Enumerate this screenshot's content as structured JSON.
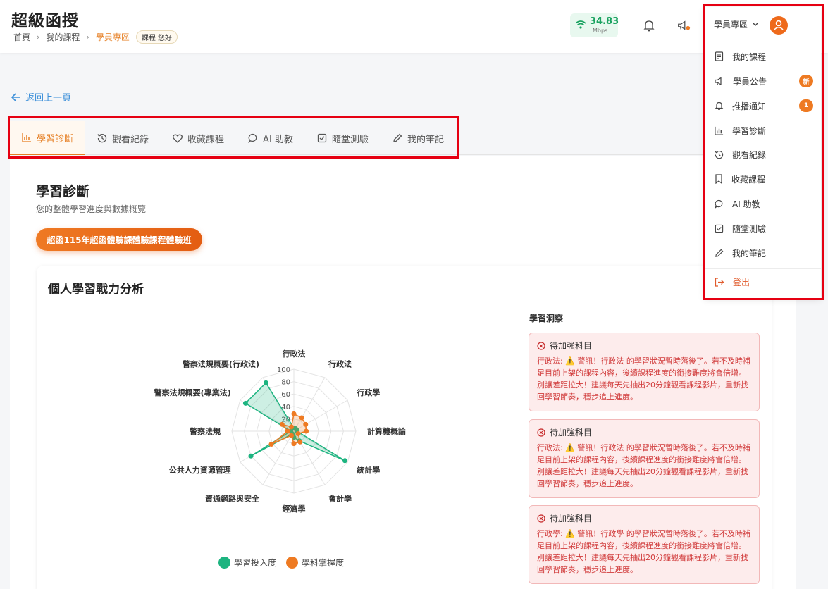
{
  "header": {
    "brand": "超級函授",
    "breadcrumb": [
      "首頁",
      "我的課程",
      "學員專區"
    ],
    "greeting_pill": "課程 您好",
    "speed_value": "34.83",
    "speed_unit": "Mbps"
  },
  "back_link": "返回上一頁",
  "tabs": [
    {
      "label": "學習診斷",
      "icon": "bar-chart-icon",
      "active": true
    },
    {
      "label": "觀看紀錄",
      "icon": "history-icon",
      "active": false
    },
    {
      "label": "收藏課程",
      "icon": "heart-icon",
      "active": false
    },
    {
      "label": "AI 助教",
      "icon": "chat-icon",
      "active": false
    },
    {
      "label": "隨堂測驗",
      "icon": "checkbox-icon",
      "active": false
    },
    {
      "label": "我的筆記",
      "icon": "pencil-icon",
      "active": false
    }
  ],
  "page": {
    "title": "學習診斷",
    "subtitle": "您的整體學習進度與數據概覽",
    "course_button": "超函115年超函體驗課體驗課程體驗班",
    "card_title": "個人學習戰力分析"
  },
  "chart_data": {
    "type": "radar",
    "categories": [
      "行政法",
      "行政法",
      "行政學",
      "計算機概論",
      "統計學",
      "會計學",
      "經濟學",
      "資通網路與安全",
      "公共人力資源管理",
      "警察法規",
      "警察法規概要(專業法)",
      "警察法規概要(行政法)"
    ],
    "ticks": [
      "100",
      "80",
      "60",
      "40",
      "20"
    ],
    "rmax": 100,
    "series": [
      {
        "name": "學習投入度",
        "color": "#1db480",
        "values": [
          5,
          5,
          5,
          5,
          95,
          18,
          10,
          5,
          80,
          5,
          90,
          90
        ]
      },
      {
        "name": "學科掌握度",
        "color": "#ee7a22",
        "values": [
          28,
          25,
          22,
          20,
          8,
          20,
          20,
          8,
          42,
          10,
          22,
          8
        ]
      }
    ]
  },
  "insights": {
    "title": "學習洞察",
    "alerts": [
      {
        "heading": "待加強科目",
        "body": "行政法: ⚠️ 警訊！行政法 的學習狀況暫時落後了。若不及時補足目前上架的課程內容，後續課程進度的銜接難度將會倍增。別讓差距拉大！建議每天先抽出20分鐘觀看課程影片，重新找回學習節奏，穩步追上進度。"
      },
      {
        "heading": "待加強科目",
        "body": "行政法: ⚠️ 警訊！行政法 的學習狀況暫時落後了。若不及時補足目前上架的課程內容，後續課程進度的銜接難度將會倍增。別讓差距拉大！建議每天先抽出20分鐘觀看課程影片，重新找回學習節奏，穩步追上進度。"
      },
      {
        "heading": "待加強科目",
        "body": "行政學: ⚠️ 警訊！行政學 的學習狀況暫時落後了。若不及時補足目前上架的課程內容，後續課程進度的銜接難度將會倍增。別讓差距拉大！建議每天先抽出20分鐘觀看課程影片，重新找回學習節奏，穩步追上進度。"
      }
    ]
  },
  "dropdown": {
    "header_label": "學員專區",
    "items": [
      {
        "label": "我的課程",
        "icon": "document-icon",
        "badge": ""
      },
      {
        "label": "學員公告",
        "icon": "megaphone-icon",
        "badge": "新"
      },
      {
        "label": "推播通知",
        "icon": "bell-icon",
        "badge": "1"
      },
      {
        "label": "學習診斷",
        "icon": "bar-chart-icon",
        "badge": ""
      },
      {
        "label": "觀看紀錄",
        "icon": "history-icon",
        "badge": ""
      },
      {
        "label": "收藏課程",
        "icon": "bookmark-icon",
        "badge": ""
      },
      {
        "label": "AI 助教",
        "icon": "chat-icon",
        "badge": ""
      },
      {
        "label": "隨堂測驗",
        "icon": "checkbox-icon",
        "badge": ""
      },
      {
        "label": "我的筆記",
        "icon": "pencil-icon",
        "badge": ""
      }
    ],
    "logout_label": "登出"
  },
  "colors": {
    "accent": "#e67e22",
    "engagement": "#1db480",
    "mastery": "#ee7a22",
    "alert_bg": "#fdecec",
    "highlight_box": "#e60012"
  }
}
